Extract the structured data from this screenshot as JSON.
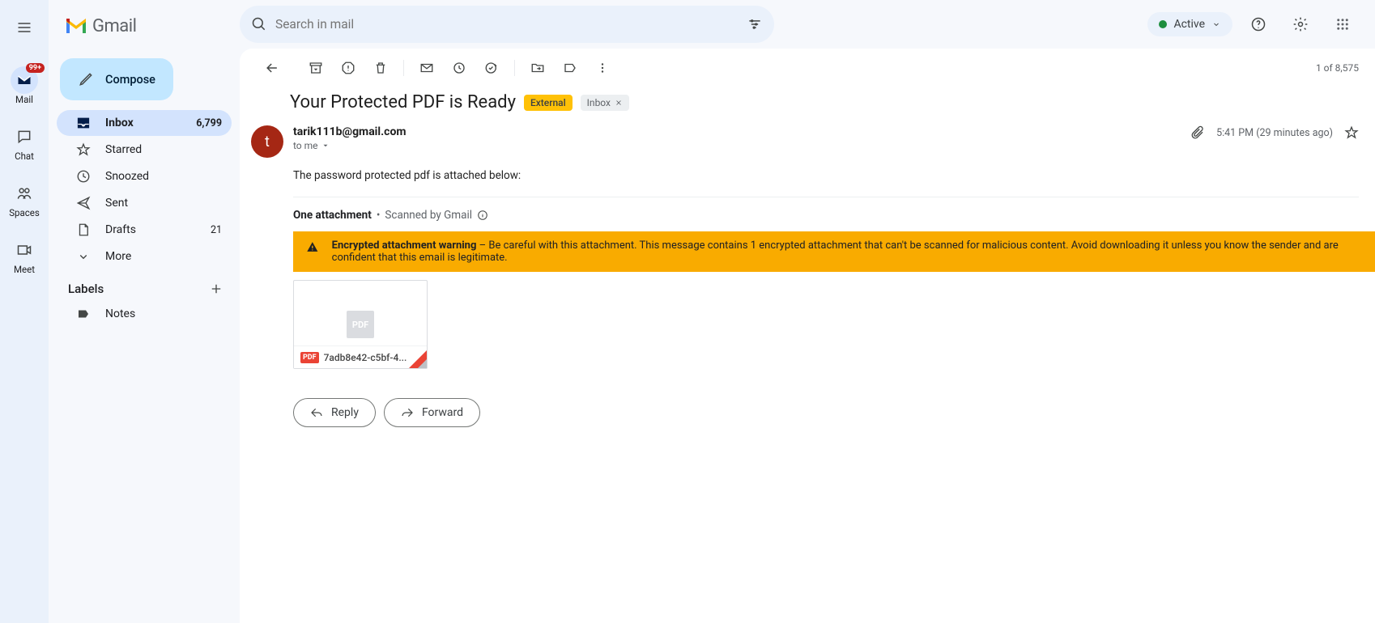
{
  "app_name": "Gmail",
  "rail": {
    "badge": "99+",
    "items": [
      {
        "label": "Mail"
      },
      {
        "label": "Chat"
      },
      {
        "label": "Spaces"
      },
      {
        "label": "Meet"
      }
    ]
  },
  "search": {
    "placeholder": "Search in mail"
  },
  "status_pill": "Active",
  "compose_label": "Compose",
  "nav": {
    "inbox": {
      "label": "Inbox",
      "count": "6,799"
    },
    "starred": {
      "label": "Starred"
    },
    "snoozed": {
      "label": "Snoozed"
    },
    "sent": {
      "label": "Sent"
    },
    "drafts": {
      "label": "Drafts",
      "count": "21"
    },
    "more": {
      "label": "More"
    }
  },
  "labels_header": "Labels",
  "labels": [
    {
      "label": "Notes"
    }
  ],
  "pagination": "1 of 8,575",
  "message": {
    "subject": "Your Protected PDF is Ready",
    "chip_external": "External",
    "chip_inbox": "Inbox",
    "sender_email": "tarik111b@gmail.com",
    "avatar_initial": "t",
    "recipient": "to me",
    "timestamp": "5:41 PM (29 minutes ago)",
    "body": "The password protected pdf is attached below:",
    "attachment_count_label": "One attachment",
    "scanned_label": "Scanned by Gmail",
    "warning_title": "Encrypted attachment warning",
    "warning_text": " – Be careful with this attachment. This message contains 1 encrypted attachment that can't be scanned for malicious content. Avoid downloading it unless you know the sender and are confident that this email is legitimate.",
    "attachment_filename": "7adb8e42-c5bf-4...",
    "reply_label": "Reply",
    "forward_label": "Forward"
  }
}
